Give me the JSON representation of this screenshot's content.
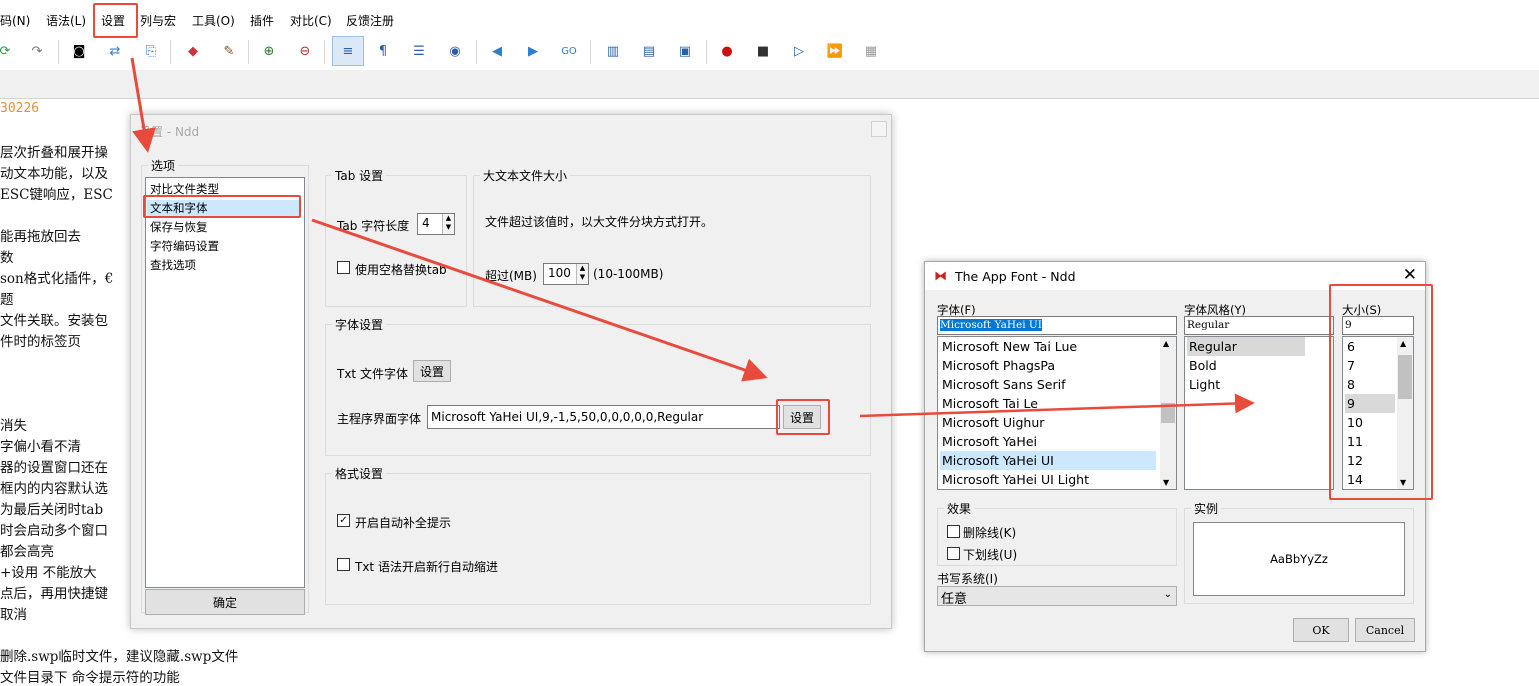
{
  "menu": {
    "items": [
      "码(N)",
      "语法(L)",
      "设置",
      "列与宏",
      "工具(O)",
      "插件",
      "对比(C)",
      "反馈注册"
    ]
  },
  "toolbar": {
    "icons": [
      "refresh-icon",
      "redo-icon",
      "binoculars-icon",
      "replace-icon",
      "bookmark-icon",
      "eraser-icon",
      "brush-icon",
      "zoom-in-icon",
      "zoom-out-icon",
      "wrap-icon",
      "pilcrow-icon",
      "indent-icon",
      "target-icon",
      "prev-icon",
      "next-icon",
      "go-icon",
      "sync-v-icon",
      "sync-h-icon",
      "monitor-icon",
      "record-icon",
      "stop-icon",
      "play-icon",
      "fast-play-icon",
      "save-macro-icon"
    ]
  },
  "editor": {
    "lines": [
      "30226",
      "层次折叠和展开操",
      "动文本功能，以及",
      "ESC键响应，ESC",
      "",
      "能再拖放回去",
      "数",
      "son格式化插件，€",
      "题",
      "文件关联。安装包",
      "件时的标签页",
      "",
      "",
      "",
      "消失",
      "字偏小看不清",
      "器的设置窗口还在",
      "框内的内容默认选",
      "为最后关闭时tab",
      "时会启动多个窗口",
      "都会高亮",
      "+设用  不能放大",
      "点后，再用快捷键",
      "取消",
      "",
      "删除.swp临时文件，建议隐藏.swp文件",
      "文件目录下  命令提示符的功能"
    ]
  },
  "settings_dialog": {
    "title": "设置 - Ndd",
    "options_legend": "选项",
    "options": [
      "对比文件类型",
      "文本和字体",
      "保存与恢复",
      "字符编码设置",
      "查找选项"
    ],
    "selected_option": "文本和字体",
    "ok_label": "确定",
    "tab_group": {
      "legend": "Tab 设置",
      "tab_length_label": "Tab 字符长度",
      "tab_length_value": "4",
      "use_space_label": "使用空格替换tab"
    },
    "bigfile_group": {
      "legend": "大文本文件大小",
      "desc": "文件超过该值时，以大文件分块方式打开。",
      "over_label": "超过(MB)",
      "over_value": "100",
      "range_label": "(10-100MB)"
    },
    "font_group": {
      "legend": "字体设置",
      "txt_font_label": "Txt 文件字体",
      "txt_font_button": "设置",
      "main_font_label": "主程序界面字体",
      "main_font_value": "Microsoft YaHei UI,9,-1,5,50,0,0,0,0,0,Regular",
      "main_font_button": "设置"
    },
    "format_group": {
      "legend": "格式设置",
      "autocomplete_label": "开启自动补全提示",
      "autocomplete_checked": true,
      "autoindent_label": "Txt 语法开启新行自动缩进",
      "autoindent_checked": false
    }
  },
  "font_dialog": {
    "title": "The App Font - Ndd",
    "font_label": "字体(F)",
    "font_value": "Microsoft YaHei UI",
    "fonts": [
      "Microsoft New Tai Lue",
      "Microsoft PhagsPa",
      "Microsoft Sans Serif",
      "Microsoft Tai Le",
      "Microsoft Uighur",
      "Microsoft YaHei",
      "Microsoft YaHei UI",
      "Microsoft YaHei UI Light"
    ],
    "selected_font": "Microsoft YaHei UI",
    "style_label": "字体风格(Y)",
    "style_value": "Regular",
    "styles": [
      "Regular",
      "Bold",
      "Light"
    ],
    "size_label": "大小(S)",
    "size_value": "9",
    "sizes": [
      "6",
      "7",
      "8",
      "9",
      "10",
      "11",
      "12",
      "14"
    ],
    "effects_legend": "效果",
    "strikeout_label": "删除线(K)",
    "underline_label": "下划线(U)",
    "sample_legend": "实例",
    "sample_text": "AaBbYyZz",
    "writing_system_label": "书写系统(I)",
    "writing_system_value": "任意",
    "ok_label": "OK",
    "cancel_label": "Cancel"
  },
  "colors": {
    "annotation_red": "#e84b3c",
    "selection_blue": "#cce8ff",
    "accent_orange": "#e8912d"
  }
}
